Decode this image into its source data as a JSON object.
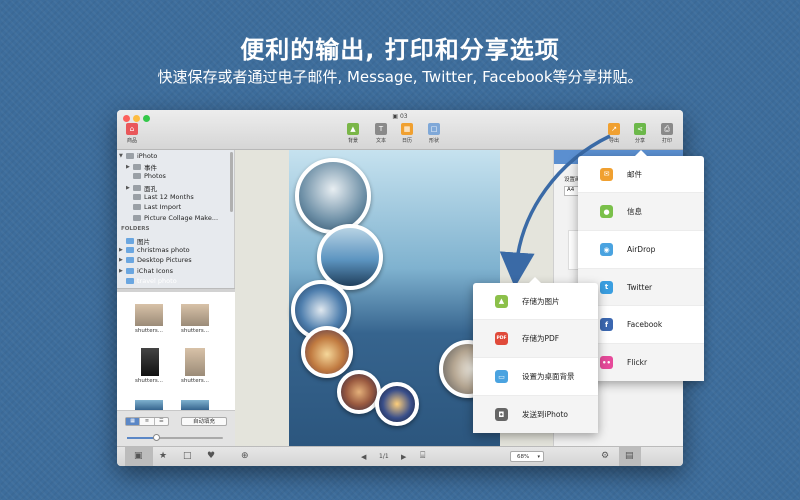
{
  "headline": "便利的输出, 打印和分享选项",
  "subheadline": "快速保存或者通过电子邮件, Message, Twitter, Facebook等分享拼贴。",
  "window": {
    "title": "03",
    "toolbar": {
      "left": {
        "label": "商品"
      },
      "center": [
        {
          "label": "背景",
          "icon": "image-icon",
          "color": "#7ab648"
        },
        {
          "label": "文本",
          "icon": "text-icon",
          "color": "#8a8a8a"
        },
        {
          "label": "日历",
          "icon": "calendar-icon",
          "color": "#f0a030"
        },
        {
          "label": "形状",
          "icon": "shape-icon",
          "color": "#7fa8d8"
        }
      ],
      "right": [
        {
          "label": "导出",
          "icon": "export-icon",
          "color": "#f0a030"
        },
        {
          "label": "分享",
          "icon": "share-icon",
          "color": "#6cb84a"
        },
        {
          "label": "打印",
          "icon": "print-icon",
          "color": "#8a8a8a"
        }
      ]
    },
    "sidebar": {
      "tree": [
        {
          "label": "iPhoto",
          "indent": 0,
          "arrow": "▼",
          "icon": "iphoto-icon"
        },
        {
          "label": "事件",
          "indent": 1,
          "arrow": "▶",
          "icon": "events-icon"
        },
        {
          "label": "Photos",
          "indent": 1,
          "arrow": "",
          "icon": "photos-icon"
        },
        {
          "label": "面孔",
          "indent": 1,
          "arrow": "▶",
          "icon": "faces-icon"
        },
        {
          "label": "Last 12 Months",
          "indent": 1,
          "arrow": "",
          "icon": "album-icon"
        },
        {
          "label": "Last Import",
          "indent": 1,
          "arrow": "",
          "icon": "album-icon"
        },
        {
          "label": "Picture Collage Make...",
          "indent": 1,
          "arrow": "",
          "icon": "album-icon"
        }
      ],
      "folders_header": "FOLDERS",
      "folders": [
        {
          "label": "图片",
          "arrow": ""
        },
        {
          "label": "christmas photo",
          "arrow": "▶"
        },
        {
          "label": "Desktop Pictures",
          "arrow": "▶"
        },
        {
          "label": "iChat Icons",
          "arrow": "▶"
        },
        {
          "label": "travel photo",
          "arrow": ""
        }
      ],
      "thumbnails": [
        {
          "label": "shutters..."
        },
        {
          "label": "shutters..."
        },
        {
          "label": "shutters..."
        },
        {
          "label": "shutters..."
        }
      ],
      "autofill_label": "自动填充"
    },
    "right_panel": {
      "label": "设置画布",
      "size_value": "A4"
    },
    "bottom": {
      "page_indicator": "1/1",
      "zoom_value": "68%"
    }
  },
  "share_menu": [
    {
      "label": "邮件",
      "icon": "mail-icon",
      "color": "#f0a030"
    },
    {
      "label": "信息",
      "icon": "messages-icon",
      "color": "#7ac04a"
    },
    {
      "label": "AirDrop",
      "icon": "airdrop-icon",
      "color": "#4aa3e0"
    },
    {
      "label": "Twitter",
      "icon": "twitter-icon",
      "color": "#3a9ee0"
    },
    {
      "label": "Facebook",
      "icon": "facebook-icon",
      "color": "#3b67b0"
    },
    {
      "label": "Flickr",
      "icon": "flickr-icon",
      "color": "#e64a9a"
    }
  ],
  "export_menu": [
    {
      "label": "存储为图片",
      "icon": "save-image-icon",
      "color": "#8cc04a"
    },
    {
      "label": "存储为PDF",
      "icon": "save-pdf-icon",
      "color": "#e04a3a"
    },
    {
      "label": "设置为桌面背景",
      "icon": "desktop-icon",
      "color": "#4aa3e0"
    },
    {
      "label": "发送到iPhoto",
      "icon": "camera-icon",
      "color": "#666666"
    }
  ]
}
